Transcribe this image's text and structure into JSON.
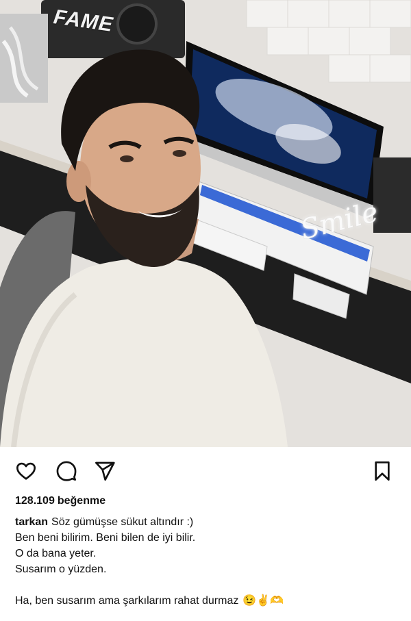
{
  "photo": {
    "speaker_brand": "FAME",
    "neon_sign": "Smile"
  },
  "actions": {
    "like_icon": "heart-icon",
    "comment_icon": "comment-icon",
    "share_icon": "send-icon",
    "save_icon": "bookmark-icon"
  },
  "likes": {
    "count": "128.109",
    "label": "beğenme"
  },
  "caption": {
    "username": "tarkan",
    "first_line": "Söz gümüşse sükut altındır :)",
    "lines": [
      "Ben beni bilirim. Beni bilen de iyi bilir.",
      "O da bana yeter.",
      "Susarım o yüzden."
    ],
    "last_line": "Ha, ben susarım ama şarkılarım rahat durmaz",
    "emojis": "😉✌️🫶"
  },
  "colors": {
    "text": "#111111",
    "muted": "#9a9a9a",
    "background": "#ffffff"
  }
}
